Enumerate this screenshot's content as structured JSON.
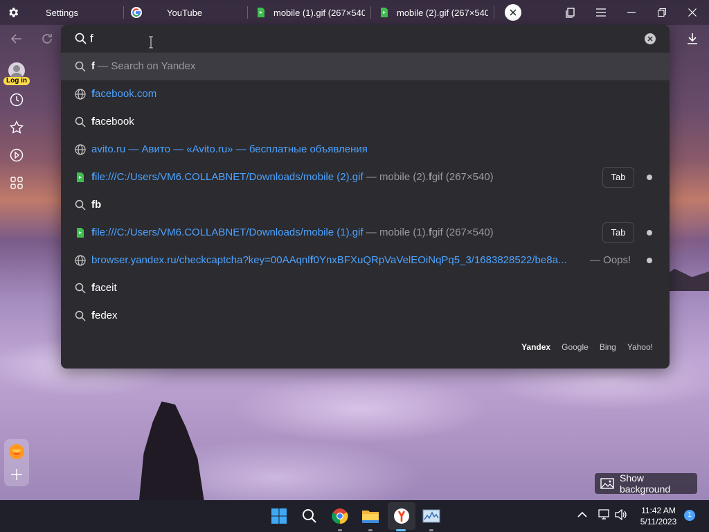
{
  "tabs": [
    {
      "title": "Settings"
    },
    {
      "title": "YouTube"
    },
    {
      "title": "mobile (1).gif (267×540"
    },
    {
      "title": "mobile (2).gif (267×540"
    }
  ],
  "omnibox": {
    "value": "f",
    "suggestions": [
      {
        "type": "search",
        "bold": "f",
        "rest": " — Search on Yandex"
      },
      {
        "type": "site",
        "bold": "f",
        "link": "acebook.com"
      },
      {
        "type": "search",
        "bold": "f",
        "rest_white": "acebook"
      },
      {
        "type": "site",
        "link": "avito.ru — Авито — «Avito.ru» — бесплатные объявления"
      },
      {
        "type": "file",
        "bold": "f",
        "link": "ile:///C:/Users/VM6.COLLABNET/Downloads/mobile (2).gif",
        "sep": " — mobile (2).",
        "bold2": "f",
        "rest": "gif",
        "dim": " (267×540)",
        "chip": "Tab"
      },
      {
        "type": "search",
        "bold": "fb"
      },
      {
        "type": "file",
        "bold": "f",
        "link": "ile:///C:/Users/VM6.COLLABNET/Downloads/mobile (1).gif",
        "sep": " — mobile (1).",
        "bold2": "f",
        "rest": "gif",
        "dim": " (267×540)",
        "chip": "Tab"
      },
      {
        "type": "site",
        "link_a": "browser.yandex.ru/checkcaptcha?key=00AAqnl",
        "bold": "f",
        "link_b": "0YnxBFXuQRpVaVelEOiNqPq5_3/1683828522/be8a...",
        "suffix": "— Oops!"
      },
      {
        "type": "search",
        "bold": "f",
        "rest_white": "aceit"
      },
      {
        "type": "search",
        "bold": "f",
        "rest_white": "edex"
      }
    ],
    "engines": [
      "Yandex",
      "Google",
      "Bing",
      "Yahoo!"
    ]
  },
  "sidebar": {
    "login_label": "Log in"
  },
  "show_background_label": "Show background",
  "clock": {
    "time": "11:42 AM",
    "date": "5/11/2023"
  },
  "notification_count": "1",
  "colors": {
    "link": "#4da3ff",
    "dropdown_bg": "#2b2b30",
    "yandex_red": "#fc3f1d"
  }
}
